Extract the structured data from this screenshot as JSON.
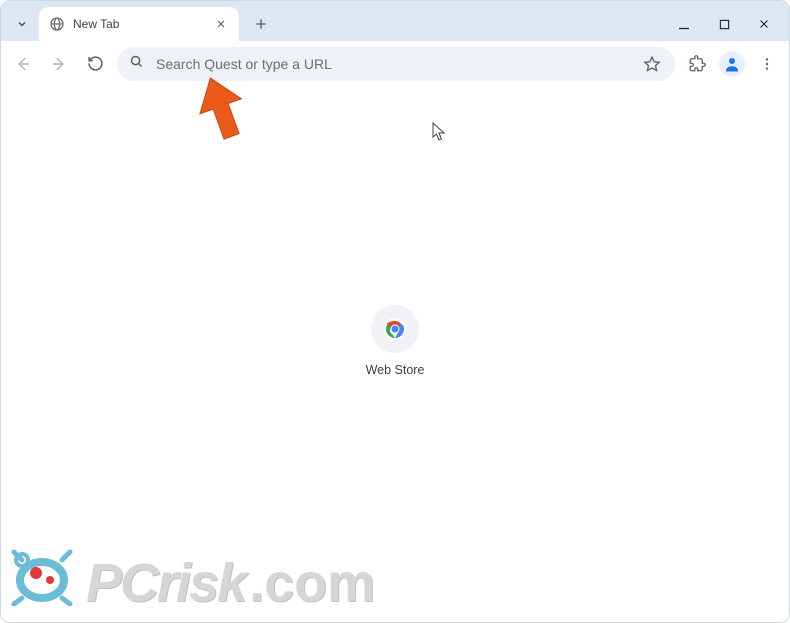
{
  "tab": {
    "title": "New Tab"
  },
  "omnibox": {
    "placeholder": "Search Quest or type a URL"
  },
  "shortcut": {
    "label": "Web Store"
  },
  "watermark": {
    "text_main": "PCrisk",
    "text_tld": ".com"
  },
  "icons": {
    "globe": "globe-icon",
    "close": "close-icon",
    "plus": "plus-icon",
    "minimize": "minimize-icon",
    "maximize": "maximize-icon",
    "window_close": "window-close-icon",
    "back": "back-icon",
    "forward": "forward-icon",
    "reload": "reload-icon",
    "search": "search-icon",
    "star": "star-icon",
    "extension": "extension-icon",
    "profile": "profile-icon",
    "menu": "dots-vertical-icon",
    "chrome": "chrome-logo-icon",
    "dropdown": "chevron-down-icon",
    "arrow_annotation": "pointer-arrow-icon",
    "cursor": "mouse-cursor-icon"
  }
}
